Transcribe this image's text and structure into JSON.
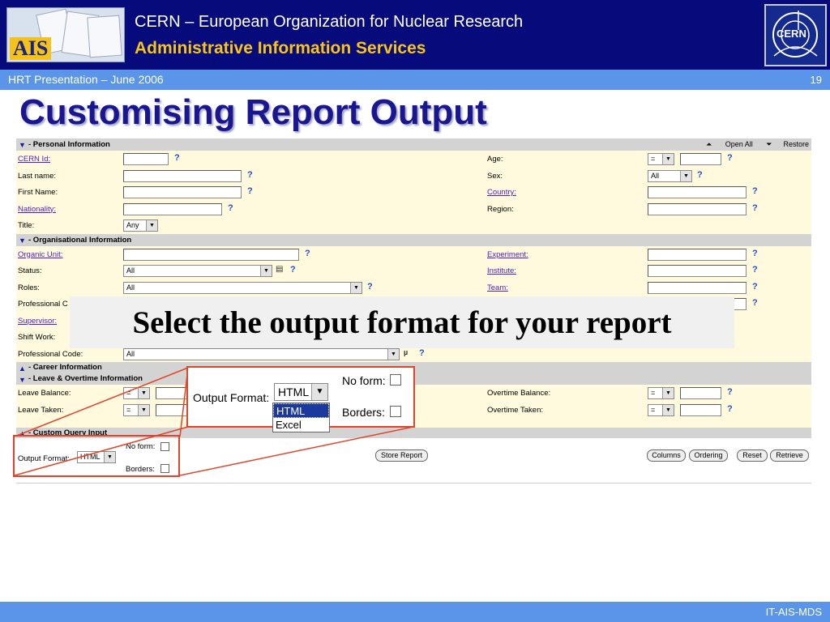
{
  "header": {
    "logo_text": "AIS",
    "org": "CERN – European Organization for Nuclear Research",
    "service": "Administrative Information Services",
    "cern_logo_text": "CERN"
  },
  "subbar": {
    "presentation": "HRT Presentation – June 2006",
    "page": "19"
  },
  "slide_title": "Customising Report Output",
  "sections": {
    "personal": "- Personal Information",
    "open_all": "Open All",
    "restore": "Restore",
    "organisational": "- Organisational Information",
    "career": "- Career Information",
    "leave": "- Leave & Overtime Information",
    "custom": "- Custom Query Input"
  },
  "personal": {
    "cern_id": "CERN Id:",
    "last_name": "Last name:",
    "first_name": "First Name:",
    "nationality": "Nationality:",
    "title": "Title:",
    "title_value": "Any",
    "age": "Age:",
    "age_op": "=",
    "sex": "Sex:",
    "sex_value": "All",
    "country": "Country:",
    "region": "Region:"
  },
  "organisational": {
    "organic_unit": "Organic Unit:",
    "status": "Status:",
    "status_value": "All",
    "roles": "Roles:",
    "roles_value": "All",
    "professional_c": "Professional C",
    "supervisor": "Supervisor:",
    "shift_work": "Shift Work:",
    "professional_code": "Professional Code:",
    "professional_code_value": "All",
    "experiment": "Experiment:",
    "institute": "Institute:",
    "team": "Team:"
  },
  "leave": {
    "leave_balance": "Leave Balance:",
    "leave_taken": "Leave Taken:",
    "overtime_balance": "Overtime Balance:",
    "overtime_taken": "Overtime Taken:",
    "op": "="
  },
  "custom": {
    "output_format": "Output Format:",
    "output_value": "HTML",
    "no_form": "No form:",
    "borders": "Borders:",
    "store_report": "Store Report",
    "columns": "Columns",
    "ordering": "Ordering",
    "reset": "Reset",
    "retrieve": "Retrieve"
  },
  "callout": "Select the output format for your report",
  "zoom": {
    "output_format": "Output Format:",
    "value": "HTML",
    "options": [
      "HTML",
      "Excel"
    ],
    "no_form": "No form:",
    "borders": "Borders:"
  },
  "footer": "IT-AIS-MDS"
}
